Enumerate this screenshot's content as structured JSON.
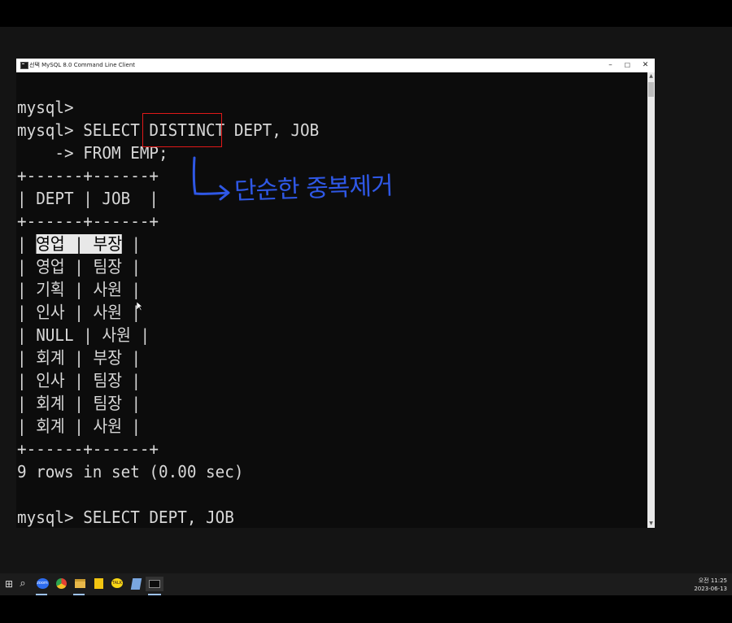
{
  "window": {
    "title": "선택 MySQL 8.0 Command Line Client",
    "controls": {
      "minimize": "–",
      "maximize": "☐",
      "close": "✕"
    }
  },
  "console": {
    "lines": [
      {
        "text": "mysql>"
      },
      {
        "text": "mysql> SELECT DISTINCT DEPT, JOB"
      },
      {
        "text": "    -> FROM EMP;"
      },
      {
        "text": "+------+------+"
      },
      {
        "text": "| DEPT | JOB  |"
      },
      {
        "text": "+------+------+"
      },
      {
        "pre": "| ",
        "sel": "영업 | 부장",
        "post": " |"
      },
      {
        "text": "| 영업 | 팀장 |"
      },
      {
        "text": "| 기획 | 사원 |"
      },
      {
        "text": "| 인사 | 사원 |"
      },
      {
        "text": "| NULL | 사원 |"
      },
      {
        "text": "| 회계 | 부장 |"
      },
      {
        "text": "| 인사 | 팀장 |"
      },
      {
        "text": "| 회계 | 팀장 |"
      },
      {
        "text": "| 회계 | 사원 |"
      },
      {
        "text": "+------+------+"
      },
      {
        "text": "9 rows in set (0.00 sec)"
      },
      {
        "text": ""
      },
      {
        "text": "mysql> SELECT DEPT, JOB"
      }
    ]
  },
  "annotation": {
    "handwritten_note": "단순한 중복제거",
    "highlight_keyword": "DISTINCT",
    "note_color": "#2f58e6",
    "highlight_color": "#e01818"
  },
  "taskbar": {
    "apps": [
      "start-icon",
      "search-icon",
      "zoom-icon",
      "chrome-icon",
      "file-explorer-icon",
      "sticky-notes-icon",
      "kakaotalk-icon",
      "app-icon",
      "command-prompt-icon"
    ],
    "zoom_label": "zoom",
    "kakao_label": "TALK",
    "clock_time": "오전 11:25",
    "clock_date": "2023-06-13"
  }
}
